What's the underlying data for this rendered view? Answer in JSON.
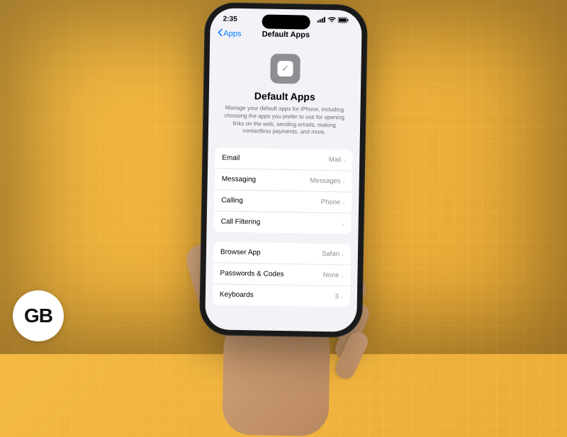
{
  "logo": "GB",
  "status": {
    "time": "2:35",
    "signal": "●●●●",
    "wifi": "⬡",
    "battery": "▮"
  },
  "nav": {
    "back_label": "Apps",
    "title": "Default Apps"
  },
  "hero": {
    "title": "Default Apps",
    "description": "Manage your default apps for iPhone, including choosing the apps you prefer to use for opening links on the web, sending emails, making contactless payments, and more."
  },
  "group1": [
    {
      "label": "Email",
      "value": "Mail"
    },
    {
      "label": "Messaging",
      "value": "Messages"
    },
    {
      "label": "Calling",
      "value": "Phone"
    },
    {
      "label": "Call Filtering",
      "value": ""
    }
  ],
  "group2": [
    {
      "label": "Browser App",
      "value": "Safari"
    },
    {
      "label": "Passwords & Codes",
      "value": "None"
    },
    {
      "label": "Keyboards",
      "value": "3"
    }
  ]
}
